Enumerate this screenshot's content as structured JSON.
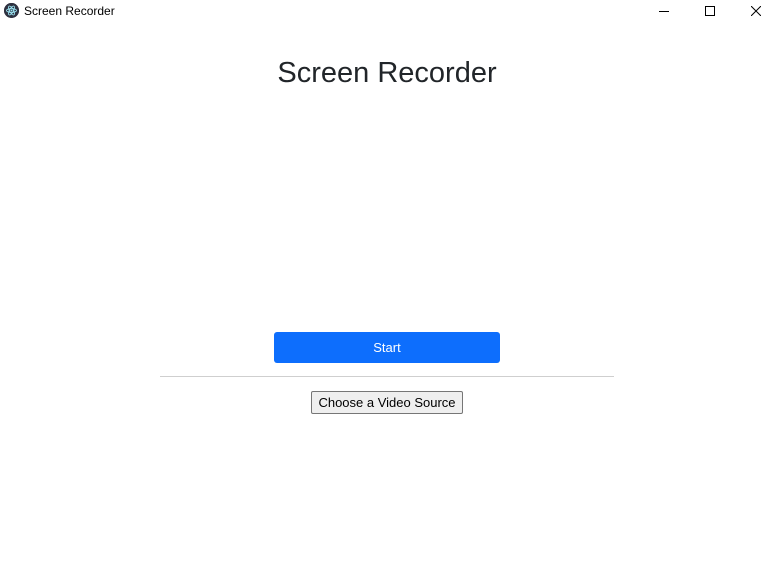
{
  "window": {
    "title": "Screen Recorder",
    "app_icon": "electron-atom-icon",
    "controls": {
      "minimize_icon": "minimize-icon",
      "maximize_icon": "maximize-icon",
      "close_icon": "close-icon"
    }
  },
  "main": {
    "heading": "Screen Recorder",
    "start_label": "Start",
    "choose_source_label": "Choose a Video Source"
  },
  "colors": {
    "primary_button": "#0d6efd",
    "heading_text": "#212529",
    "divider": "#cfcfcf",
    "secondary_button_bg": "#efefef"
  }
}
